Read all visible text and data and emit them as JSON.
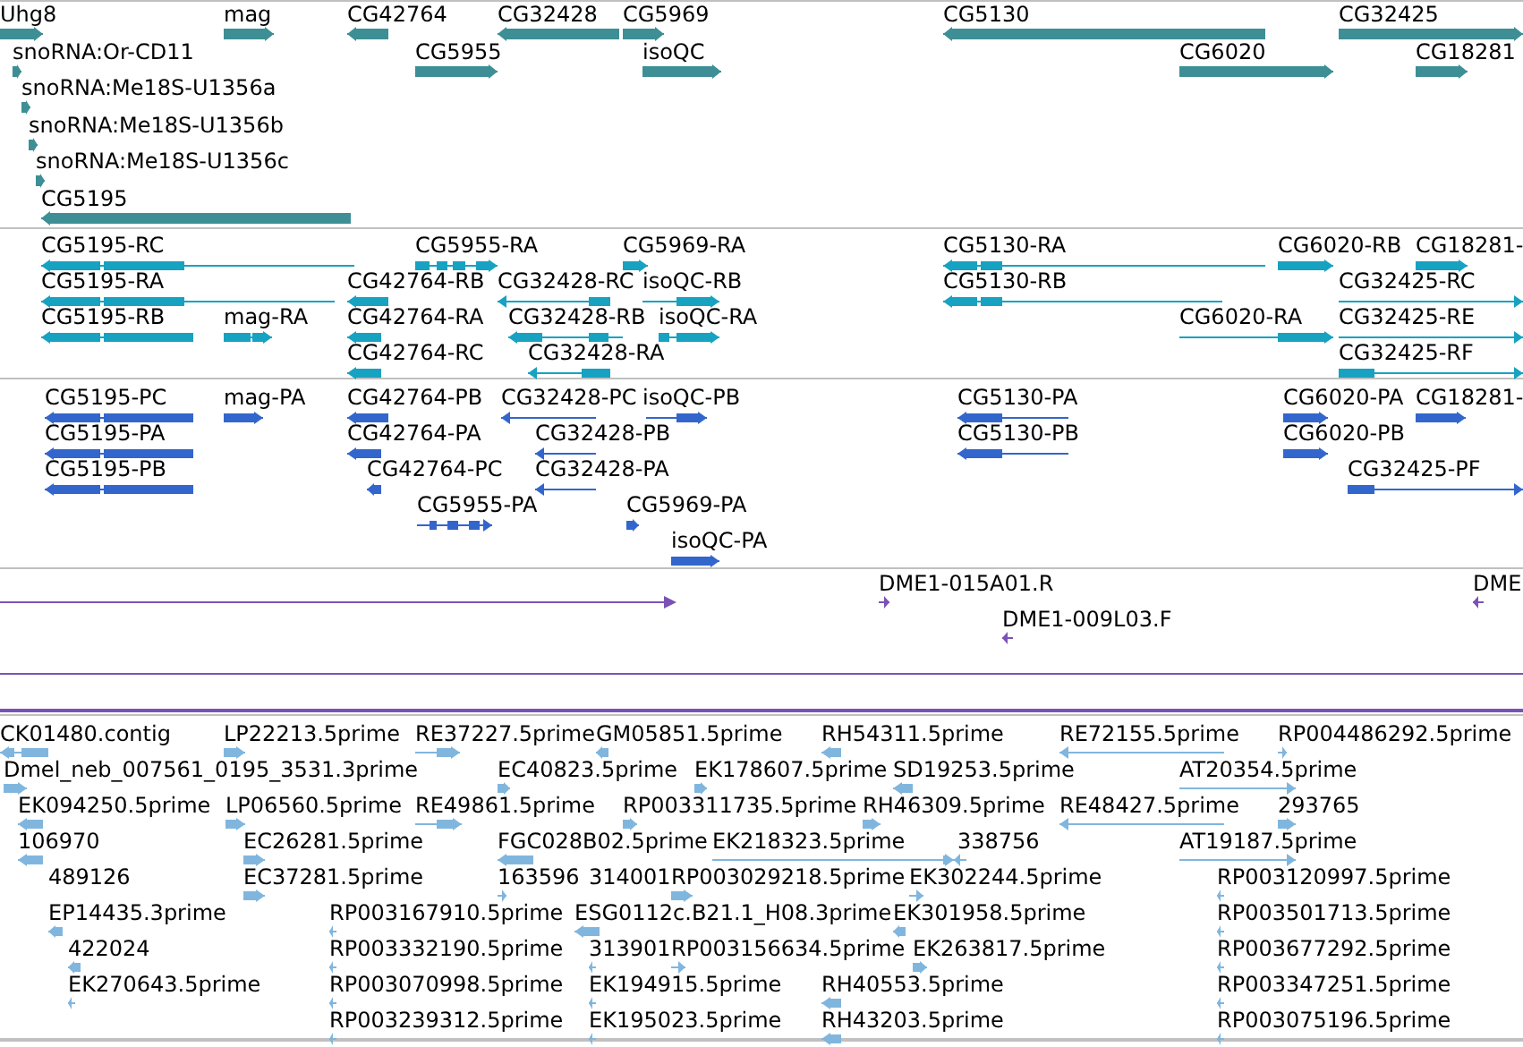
{
  "tracks": [
    {
      "kind": "genes",
      "color": "#3d8f95",
      "features": [
        {
          "label": "Uhg8",
          "reverse": false
        },
        {
          "label": "mag",
          "reverse": false
        },
        {
          "label": "CG42764",
          "reverse": true
        },
        {
          "label": "CG32428",
          "reverse": true
        },
        {
          "label": "CG5969",
          "reverse": false
        },
        {
          "label": "CG5130",
          "reverse": true
        },
        {
          "label": "CG32425",
          "reverse": false
        },
        {
          "label": "snoRNA:Or-CD11",
          "reverse": false
        },
        {
          "label": "CG5955",
          "reverse": false
        },
        {
          "label": "isoQC",
          "reverse": false
        },
        {
          "label": "CG6020",
          "reverse": false
        },
        {
          "label": "CG18281",
          "reverse": false
        },
        {
          "label": "snoRNA:Me18S-U1356a",
          "reverse": false
        },
        {
          "label": "snoRNA:Me18S-U1356b",
          "reverse": false
        },
        {
          "label": "snoRNA:Me18S-U1356c",
          "reverse": false
        },
        {
          "label": "CG5195",
          "reverse": true
        }
      ]
    },
    {
      "kind": "transcripts",
      "color": "#17a2c2",
      "features": [
        {
          "label": "CG5195-RC",
          "reverse": true
        },
        {
          "label": "CG5955-RA",
          "reverse": false
        },
        {
          "label": "CG5969-RA",
          "reverse": false
        },
        {
          "label": "CG5130-RA",
          "reverse": true
        },
        {
          "label": "CG6020-RB",
          "reverse": false
        },
        {
          "label": "CG18281-",
          "reverse": false
        },
        {
          "label": "CG5195-RA",
          "reverse": true
        },
        {
          "label": "CG42764-RB",
          "reverse": true
        },
        {
          "label": "CG32428-RC",
          "reverse": true
        },
        {
          "label": "isoQC-RB",
          "reverse": false
        },
        {
          "label": "CG5130-RB",
          "reverse": true
        },
        {
          "label": "CG32425-RC",
          "reverse": false
        },
        {
          "label": "CG5195-RB",
          "reverse": true
        },
        {
          "label": "mag-RA",
          "reverse": false
        },
        {
          "label": "CG42764-RA",
          "reverse": true
        },
        {
          "label": "CG32428-RB",
          "reverse": true
        },
        {
          "label": "isoQC-RA",
          "reverse": false
        },
        {
          "label": "CG6020-RA",
          "reverse": false
        },
        {
          "label": "CG32425-RE",
          "reverse": false
        },
        {
          "label": "CG42764-RC",
          "reverse": true
        },
        {
          "label": "CG32428-RA",
          "reverse": true
        },
        {
          "label": "CG32425-RF",
          "reverse": false
        }
      ]
    },
    {
      "kind": "proteins",
      "color": "#3366cc",
      "features": [
        {
          "label": "CG5195-PC",
          "reverse": true
        },
        {
          "label": "mag-PA",
          "reverse": false
        },
        {
          "label": "CG42764-PB",
          "reverse": true
        },
        {
          "label": "CG32428-PC",
          "reverse": true
        },
        {
          "label": "isoQC-PB",
          "reverse": false
        },
        {
          "label": "CG5130-PA",
          "reverse": true
        },
        {
          "label": "CG6020-PA",
          "reverse": false
        },
        {
          "label": "CG18281-",
          "reverse": false
        },
        {
          "label": "CG5195-PA",
          "reverse": true
        },
        {
          "label": "CG42764-PA",
          "reverse": true
        },
        {
          "label": "CG32428-PB",
          "reverse": true
        },
        {
          "label": "CG5130-PB",
          "reverse": true
        },
        {
          "label": "CG6020-PB",
          "reverse": false
        },
        {
          "label": "CG5195-PB",
          "reverse": true
        },
        {
          "label": "CG42764-PC",
          "reverse": true
        },
        {
          "label": "CG32428-PA",
          "reverse": true
        },
        {
          "label": "CG32425-PF",
          "reverse": false
        },
        {
          "label": "CG5955-PA",
          "reverse": false
        },
        {
          "label": "CG5969-PA",
          "reverse": false
        },
        {
          "label": "isoQC-PA",
          "reverse": false
        }
      ]
    },
    {
      "kind": "clones",
      "color": "#7b52b4",
      "features": [
        {
          "label": "DME1-015A01.R",
          "reverse": false
        },
        {
          "label": "DME1-009L03.F",
          "reverse": true
        },
        {
          "label": "DME",
          "reverse": true
        }
      ]
    },
    {
      "kind": "ests",
      "color": "#80b6de",
      "features": [
        {
          "label": "CK01480.contig",
          "reverse": true
        },
        {
          "label": "LP22213.5prime",
          "reverse": false
        },
        {
          "label": "RE37227.5prime",
          "reverse": false
        },
        {
          "label": "GM05851.5prime",
          "reverse": true
        },
        {
          "label": "RH54311.5prime",
          "reverse": true
        },
        {
          "label": "RE72155.5prime",
          "reverse": true
        },
        {
          "label": "RP004486292.5prime",
          "reverse": false
        },
        {
          "label": "Dmel_neb_007561_0195_3531.3prime",
          "reverse": false
        },
        {
          "label": "EC40823.5prime",
          "reverse": false
        },
        {
          "label": "EK178607.5prime",
          "reverse": false
        },
        {
          "label": "SD19253.5prime",
          "reverse": true
        },
        {
          "label": "AT20354.5prime",
          "reverse": false
        },
        {
          "label": "EK094250.5prime",
          "reverse": true
        },
        {
          "label": "LP06560.5prime",
          "reverse": false
        },
        {
          "label": "RE49861.5prime",
          "reverse": false
        },
        {
          "label": "RP003311735.5prime",
          "reverse": false
        },
        {
          "label": "RH46309.5prime",
          "reverse": false
        },
        {
          "label": "RE48427.5prime",
          "reverse": true
        },
        {
          "label": "293765",
          "reverse": false
        },
        {
          "label": "106970",
          "reverse": true
        },
        {
          "label": "EC26281.5prime",
          "reverse": false
        },
        {
          "label": "FGC028B02.5prime",
          "reverse": true
        },
        {
          "label": "EK218323.5prime",
          "reverse": false
        },
        {
          "label": "338756",
          "reverse": true
        },
        {
          "label": "AT19187.5prime",
          "reverse": false
        },
        {
          "label": "489126"
        },
        {
          "label": "EC37281.5prime",
          "reverse": false
        },
        {
          "label": "163596",
          "reverse": false
        },
        {
          "label": "314001"
        },
        {
          "label": "RP003029218.5prime",
          "reverse": false
        },
        {
          "label": "EK302244.5prime",
          "reverse": false
        },
        {
          "label": "RP003120997.5prime",
          "reverse": true
        },
        {
          "label": "EP14435.3prime",
          "reverse": true
        },
        {
          "label": "RP003167910.5prime",
          "reverse": true
        },
        {
          "label": "ESG0112c.B21.1_H08.3prime",
          "reverse": true
        },
        {
          "label": "EK301958.5prime",
          "reverse": true
        },
        {
          "label": "RP003501713.5prime",
          "reverse": true
        },
        {
          "label": "422024",
          "reverse": true
        },
        {
          "label": "RP003332190.5prime",
          "reverse": true
        },
        {
          "label": "313901",
          "reverse": true
        },
        {
          "label": "RP003156634.5prime",
          "reverse": false
        },
        {
          "label": "EK263817.5prime",
          "reverse": false
        },
        {
          "label": "RP003677292.5prime",
          "reverse": true
        },
        {
          "label": "EK270643.5prime",
          "reverse": true
        },
        {
          "label": "RP003070998.5prime",
          "reverse": true
        },
        {
          "label": "EK194915.5prime",
          "reverse": true
        },
        {
          "label": "RH40553.5prime",
          "reverse": true
        },
        {
          "label": "RP003347251.5prime",
          "reverse": true
        },
        {
          "label": "RP003239312.5prime",
          "reverse": true
        },
        {
          "label": "EK195023.5prime",
          "reverse": true
        },
        {
          "label": "RH43203.5prime",
          "reverse": true
        },
        {
          "label": "RP003075196.5prime",
          "reverse": true
        }
      ]
    }
  ]
}
